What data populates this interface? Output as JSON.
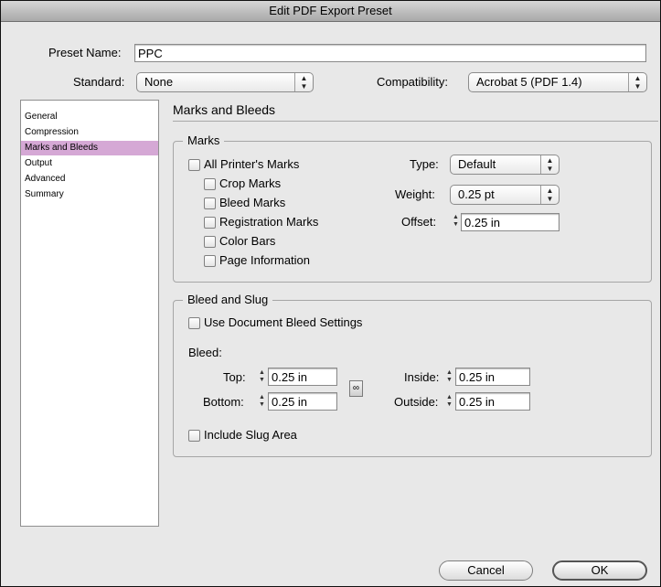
{
  "window": {
    "title": "Edit PDF Export Preset"
  },
  "preset_name": {
    "label": "Preset Name:",
    "value": "PPC"
  },
  "standard": {
    "label": "Standard:",
    "value": "None"
  },
  "compatibility": {
    "label": "Compatibility:",
    "value": "Acrobat 5 (PDF 1.4)"
  },
  "sidebar": {
    "items": [
      {
        "label": "General",
        "selected": false
      },
      {
        "label": "Compression",
        "selected": false
      },
      {
        "label": "Marks and Bleeds",
        "selected": true
      },
      {
        "label": "Output",
        "selected": false
      },
      {
        "label": "Advanced",
        "selected": false
      },
      {
        "label": "Summary",
        "selected": false
      }
    ],
    "selected_color": "#d5a8d5"
  },
  "section_title": "Marks and Bleeds",
  "marks": {
    "title": "Marks",
    "all_printers_marks": {
      "label": "All Printer's Marks",
      "checked": false
    },
    "crop_marks": {
      "label": "Crop Marks",
      "checked": false
    },
    "bleed_marks": {
      "label": "Bleed Marks",
      "checked": false
    },
    "registration_marks": {
      "label": "Registration Marks",
      "checked": false
    },
    "color_bars": {
      "label": "Color Bars",
      "checked": false
    },
    "page_information": {
      "label": "Page Information",
      "checked": false
    },
    "type": {
      "label": "Type:",
      "value": "Default"
    },
    "weight": {
      "label": "Weight:",
      "value": "0.25 pt"
    },
    "offset": {
      "label": "Offset:",
      "value": "0.25 in"
    }
  },
  "bleed_slug": {
    "title": "Bleed and Slug",
    "use_document_bleed": {
      "label": "Use Document Bleed Settings",
      "checked": false
    },
    "bleed_label": "Bleed:",
    "top": {
      "label": "Top:",
      "value": "0.25 in"
    },
    "bottom": {
      "label": "Bottom:",
      "value": "0.25 in"
    },
    "inside": {
      "label": "Inside:",
      "value": "0.25 in"
    },
    "outside": {
      "label": "Outside:",
      "value": "0.25 in"
    },
    "include_slug": {
      "label": "Include Slug Area",
      "checked": false
    }
  },
  "buttons": {
    "cancel": "Cancel",
    "ok": "OK"
  },
  "icons": {
    "popup_arrows": "updown-arrows-icon",
    "stepper": "stepper-icon",
    "chain": "chain-link-icon"
  }
}
